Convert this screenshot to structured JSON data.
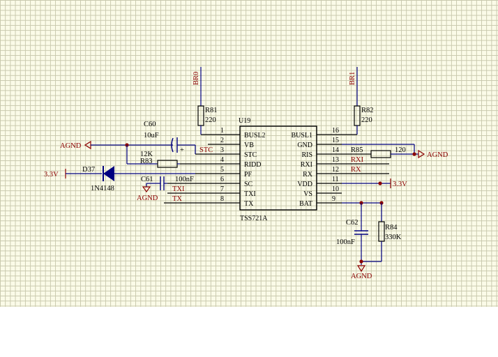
{
  "chip": {
    "designator": "U19",
    "part": "TSS721A",
    "left_pins": [
      {
        "num": "1",
        "name": "BUSL2"
      },
      {
        "num": "2",
        "name": "VB"
      },
      {
        "num": "3",
        "name": "STC"
      },
      {
        "num": "4",
        "name": "RIDD"
      },
      {
        "num": "5",
        "name": "PF"
      },
      {
        "num": "6",
        "name": "SC"
      },
      {
        "num": "7",
        "name": "TXI"
      },
      {
        "num": "8",
        "name": "TX"
      }
    ],
    "right_pins": [
      {
        "num": "16",
        "name": "BUSL1"
      },
      {
        "num": "15",
        "name": "GND"
      },
      {
        "num": "14",
        "name": "RIS"
      },
      {
        "num": "13",
        "name": "RXI"
      },
      {
        "num": "12",
        "name": "RX"
      },
      {
        "num": "11",
        "name": "VDD"
      },
      {
        "num": "10",
        "name": "VS"
      },
      {
        "num": "9",
        "name": "BAT"
      }
    ]
  },
  "components": {
    "r81": {
      "ref": "R81",
      "value": "220"
    },
    "r82": {
      "ref": "R82",
      "value": "220"
    },
    "r83": {
      "ref": "R83",
      "value": "12K"
    },
    "r84": {
      "ref": "R84",
      "value": "330K"
    },
    "r85": {
      "ref": "R85",
      "value": "120"
    },
    "c60": {
      "ref": "C60",
      "value": "10uF"
    },
    "c61": {
      "ref": "C61",
      "value": "100nF"
    },
    "c62": {
      "ref": "C62",
      "value": "100nF"
    },
    "d37": {
      "ref": "D37",
      "value": "1N4148"
    }
  },
  "nets": {
    "br0": "BR0",
    "br1": "BR1",
    "stc": "STC",
    "txi": "TXI",
    "tx": "TX",
    "rxi": "RXI",
    "rx": "RX",
    "agnd": "AGND",
    "v33": "3.3V",
    "plus": "+"
  }
}
